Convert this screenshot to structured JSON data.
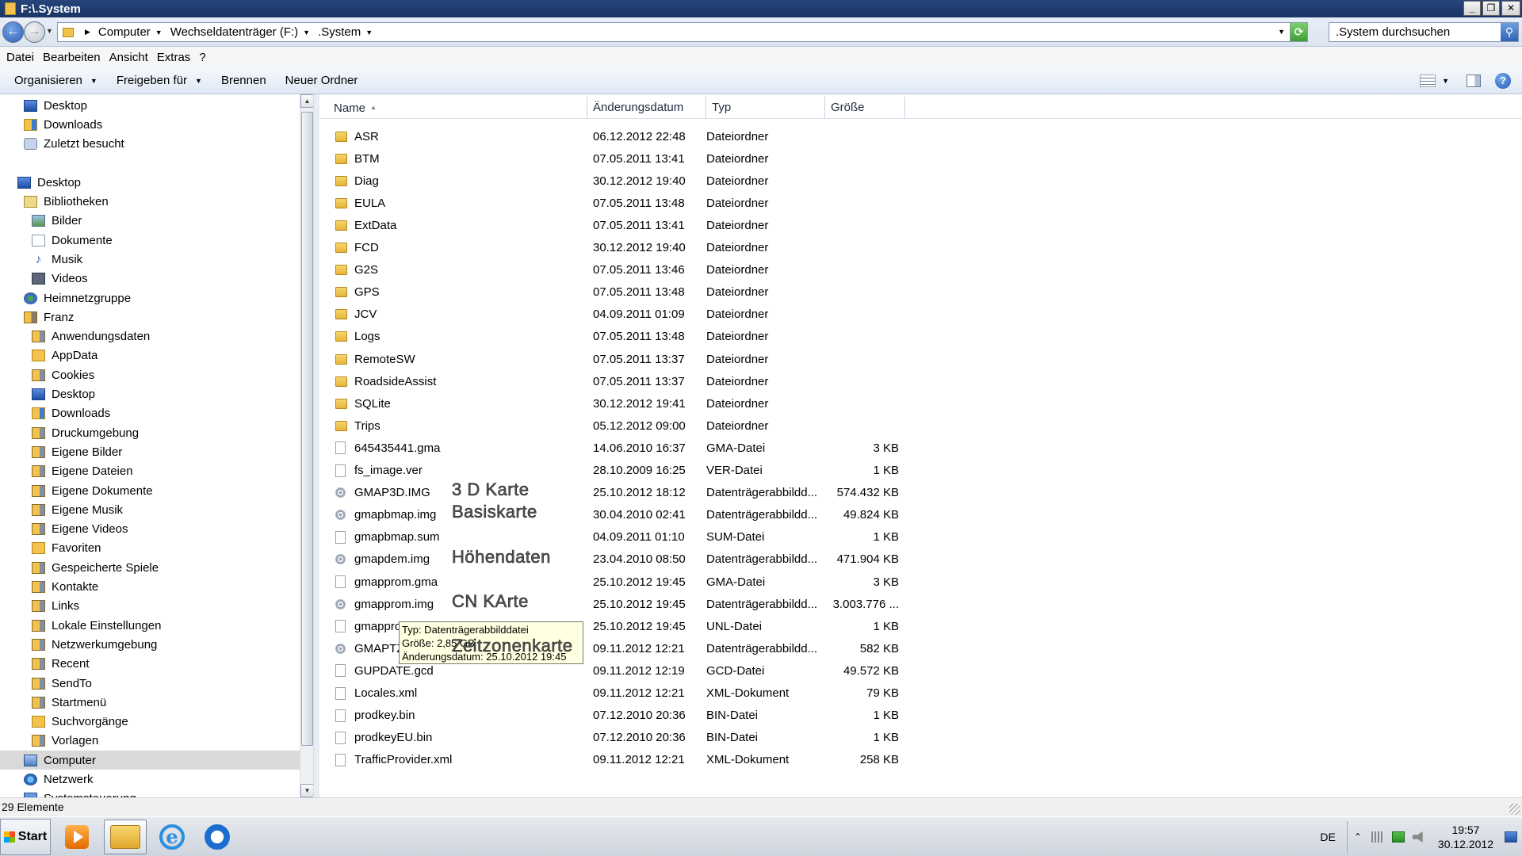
{
  "window": {
    "title": "F:\\.System"
  },
  "address": {
    "crumbs": [
      "Computer",
      "Wechseldatenträger (F:)",
      ".System"
    ],
    "search_placeholder": ".System durchsuchen"
  },
  "menu": [
    "Datei",
    "Bearbeiten",
    "Ansicht",
    "Extras",
    "?"
  ],
  "commands": {
    "organize": "Organisieren",
    "share": "Freigeben für",
    "burn": "Brennen",
    "new_folder": "Neuer Ordner"
  },
  "nav": [
    {
      "label": "Desktop",
      "icon": "desktop-icon",
      "indent": 1
    },
    {
      "label": "Downloads",
      "icon": "downloads-folder-icon",
      "indent": 1
    },
    {
      "label": "Zuletzt besucht",
      "icon": "recent-places-icon",
      "indent": 1
    },
    {
      "label": "",
      "icon": "",
      "indent": 0
    },
    {
      "label": "Desktop",
      "icon": "desktop-icon",
      "indent": 0
    },
    {
      "label": "Bibliotheken",
      "icon": "libraries-icon",
      "indent": 1
    },
    {
      "label": "Bilder",
      "icon": "pictures-icon",
      "indent": 2
    },
    {
      "label": "Dokumente",
      "icon": "documents-icon",
      "indent": 2
    },
    {
      "label": "Musik",
      "icon": "music-icon",
      "indent": 2
    },
    {
      "label": "Videos",
      "icon": "videos-icon",
      "indent": 2
    },
    {
      "label": "Heimnetzgruppe",
      "icon": "homegroup-icon",
      "indent": 1
    },
    {
      "label": "Franz",
      "icon": "user-folder-icon",
      "indent": 1
    },
    {
      "label": "Anwendungsdaten",
      "icon": "special-folder-icon",
      "indent": 2
    },
    {
      "label": "AppData",
      "icon": "folder-icon",
      "indent": 2
    },
    {
      "label": "Cookies",
      "icon": "special-folder-icon",
      "indent": 2
    },
    {
      "label": "Desktop",
      "icon": "desktop-folder-icon",
      "indent": 2
    },
    {
      "label": "Downloads",
      "icon": "downloads-folder-icon",
      "indent": 2
    },
    {
      "label": "Druckumgebung",
      "icon": "special-folder-icon",
      "indent": 2
    },
    {
      "label": "Eigene Bilder",
      "icon": "special-folder-icon",
      "indent": 2
    },
    {
      "label": "Eigene Dateien",
      "icon": "special-folder-icon",
      "indent": 2
    },
    {
      "label": "Eigene Dokumente",
      "icon": "special-folder-icon",
      "indent": 2
    },
    {
      "label": "Eigene Musik",
      "icon": "special-folder-icon",
      "indent": 2
    },
    {
      "label": "Eigene Videos",
      "icon": "special-folder-icon",
      "indent": 2
    },
    {
      "label": "Favoriten",
      "icon": "folder-icon",
      "indent": 2
    },
    {
      "label": "Gespeicherte Spiele",
      "icon": "special-folder-icon",
      "indent": 2
    },
    {
      "label": "Kontakte",
      "icon": "special-folder-icon",
      "indent": 2
    },
    {
      "label": "Links",
      "icon": "special-folder-icon",
      "indent": 2
    },
    {
      "label": "Lokale Einstellungen",
      "icon": "special-folder-icon",
      "indent": 2
    },
    {
      "label": "Netzwerkumgebung",
      "icon": "special-folder-icon",
      "indent": 2
    },
    {
      "label": "Recent",
      "icon": "special-folder-icon",
      "indent": 2
    },
    {
      "label": "SendTo",
      "icon": "special-folder-icon",
      "indent": 2
    },
    {
      "label": "Startmenü",
      "icon": "special-folder-icon",
      "indent": 2
    },
    {
      "label": "Suchvorgänge",
      "icon": "folder-icon",
      "indent": 2
    },
    {
      "label": "Vorlagen",
      "icon": "special-folder-icon",
      "indent": 2
    },
    {
      "label": "Computer",
      "icon": "computer-icon",
      "indent": 1,
      "selected": true
    },
    {
      "label": "Netzwerk",
      "icon": "network-icon",
      "indent": 1
    },
    {
      "label": "Systemsteuerung",
      "icon": "control-panel-icon",
      "indent": 1
    }
  ],
  "columns": {
    "name": "Name",
    "date": "Änderungsdatum",
    "type": "Typ",
    "size": "Größe"
  },
  "files": [
    {
      "name": "ASR",
      "date": "06.12.2012 22:48",
      "type": "Dateiordner",
      "size": "",
      "kind": "folder"
    },
    {
      "name": "BTM",
      "date": "07.05.2011 13:41",
      "type": "Dateiordner",
      "size": "",
      "kind": "folder"
    },
    {
      "name": "Diag",
      "date": "30.12.2012 19:40",
      "type": "Dateiordner",
      "size": "",
      "kind": "folder"
    },
    {
      "name": "EULA",
      "date": "07.05.2011 13:48",
      "type": "Dateiordner",
      "size": "",
      "kind": "folder"
    },
    {
      "name": "ExtData",
      "date": "07.05.2011 13:41",
      "type": "Dateiordner",
      "size": "",
      "kind": "folder"
    },
    {
      "name": "FCD",
      "date": "30.12.2012 19:40",
      "type": "Dateiordner",
      "size": "",
      "kind": "folder"
    },
    {
      "name": "G2S",
      "date": "07.05.2011 13:46",
      "type": "Dateiordner",
      "size": "",
      "kind": "folder"
    },
    {
      "name": "GPS",
      "date": "07.05.2011 13:48",
      "type": "Dateiordner",
      "size": "",
      "kind": "folder"
    },
    {
      "name": "JCV",
      "date": "04.09.2011 01:09",
      "type": "Dateiordner",
      "size": "",
      "kind": "folder"
    },
    {
      "name": "Logs",
      "date": "07.05.2011 13:48",
      "type": "Dateiordner",
      "size": "",
      "kind": "folder"
    },
    {
      "name": "RemoteSW",
      "date": "07.05.2011 13:37",
      "type": "Dateiordner",
      "size": "",
      "kind": "folder"
    },
    {
      "name": "RoadsideAssist",
      "date": "07.05.2011 13:37",
      "type": "Dateiordner",
      "size": "",
      "kind": "folder"
    },
    {
      "name": "SQLite",
      "date": "30.12.2012 19:41",
      "type": "Dateiordner",
      "size": "",
      "kind": "folder"
    },
    {
      "name": "Trips",
      "date": "05.12.2012 09:00",
      "type": "Dateiordner",
      "size": "",
      "kind": "folder"
    },
    {
      "name": "645435441.gma",
      "date": "14.06.2010 16:37",
      "type": "GMA-Datei",
      "size": "3 KB",
      "kind": "file"
    },
    {
      "name": "fs_image.ver",
      "date": "28.10.2009 16:25",
      "type": "VER-Datei",
      "size": "1 KB",
      "kind": "file"
    },
    {
      "name": "GMAP3D.IMG",
      "date": "25.10.2012 18:12",
      "type": "Datenträgerabbildd...",
      "size": "574.432 KB",
      "kind": "image"
    },
    {
      "name": "gmapbmap.img",
      "date": "30.04.2010 02:41",
      "type": "Datenträgerabbildd...",
      "size": "49.824 KB",
      "kind": "image"
    },
    {
      "name": "gmapbmap.sum",
      "date": "04.09.2011 01:10",
      "type": "SUM-Datei",
      "size": "1 KB",
      "kind": "file"
    },
    {
      "name": "gmapdem.img",
      "date": "23.04.2010 08:50",
      "type": "Datenträgerabbildd...",
      "size": "471.904 KB",
      "kind": "image"
    },
    {
      "name": "gmapprom.gma",
      "date": "25.10.2012 19:45",
      "type": "GMA-Datei",
      "size": "3 KB",
      "kind": "file"
    },
    {
      "name": "gmapprom.img",
      "date": "25.10.2012 19:45",
      "type": "Datenträgerabbildd...",
      "size": "3.003.776 ...",
      "kind": "image"
    },
    {
      "name": "gmappro",
      "date": "25.10.2012 19:45",
      "type": "UNL-Datei",
      "size": "1 KB",
      "kind": "file"
    },
    {
      "name": "GMAPTZ.",
      "date": "09.11.2012 12:21",
      "type": "Datenträgerabbildd...",
      "size": "582 KB",
      "kind": "image"
    },
    {
      "name": "GUPDATE.gcd",
      "date": "09.11.2012 12:19",
      "type": "GCD-Datei",
      "size": "49.572 KB",
      "kind": "file"
    },
    {
      "name": "Locales.xml",
      "date": "09.11.2012 12:21",
      "type": "XML-Dokument",
      "size": "79 KB",
      "kind": "file"
    },
    {
      "name": "prodkey.bin",
      "date": "07.12.2010 20:36",
      "type": "BIN-Datei",
      "size": "1 KB",
      "kind": "file"
    },
    {
      "name": "prodkeyEU.bin",
      "date": "07.12.2010 20:36",
      "type": "BIN-Datei",
      "size": "1 KB",
      "kind": "file"
    },
    {
      "name": "TrafficProvider.xml",
      "date": "09.11.2012 12:21",
      "type": "XML-Dokument",
      "size": "258 KB",
      "kind": "file"
    }
  ],
  "annotations": {
    "a1": "3 D Karte",
    "a2": "Basiskarte",
    "a3": "Höhendaten",
    "a4": "CN KArte",
    "a5": "Zeitzonenkarte"
  },
  "tooltip": {
    "type": "Typ: Datenträgerabbilddatei",
    "size": "Größe: 2,85 GB",
    "date": "Änderungsdatum: 25.10.2012 19:45"
  },
  "status": {
    "count": "29 Elemente"
  },
  "taskbar": {
    "start": "Start",
    "lang": "DE",
    "time": "19:57",
    "date": "30.12.2012"
  }
}
